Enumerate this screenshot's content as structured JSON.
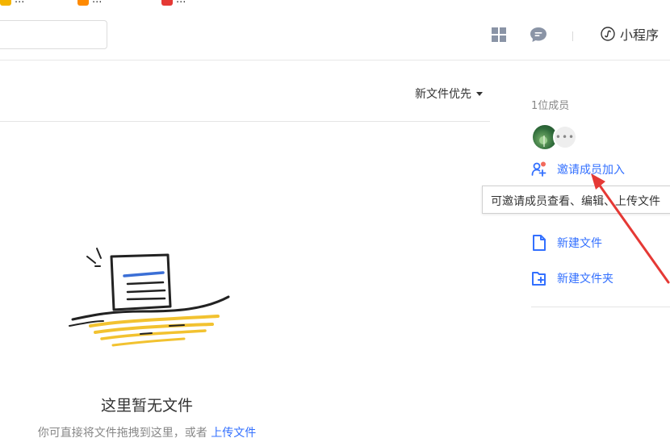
{
  "bookmarks": [
    {
      "label": "..."
    },
    {
      "label": "..."
    },
    {
      "label": "..."
    }
  ],
  "toolbar": {
    "mini_program_label": "小程序",
    "grid_icon": "apps-grid-icon",
    "chat_icon": "chat-bubble-icon"
  },
  "sort": {
    "label": "新文件优先"
  },
  "empty_state": {
    "title": "这里暂无文件",
    "subtitle_prefix": "你可直接将文件拖拽到这里，或者 ",
    "upload_link": "上传文件"
  },
  "members": {
    "count_label": "1位成员",
    "more_label": "•••"
  },
  "actions": {
    "invite": "邀请成员加入",
    "new_file": "新建文件",
    "new_folder": "新建文件夹"
  },
  "tooltip": {
    "text": "可邀请成员查看、编辑、上传文件"
  },
  "colors": {
    "accent": "#3370ff",
    "annotation_arrow": "#e53935"
  }
}
